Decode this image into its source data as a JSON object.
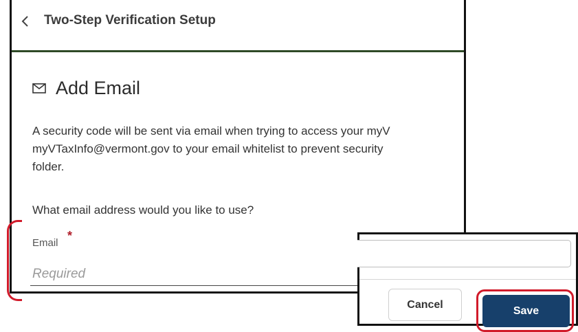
{
  "header": {
    "back_icon": "chevron-left-icon",
    "title": "Two-Step Verification Setup"
  },
  "section": {
    "icon": "mail-icon",
    "title": "Add Email",
    "description": "A security code will be sent via email when trying to access your myV\nmyVTaxInfo@vermont.gov to your email whitelist to prevent security\nfolder.",
    "question": "What email address would you like to use?"
  },
  "form": {
    "email_label": "Email",
    "required_marker": "*",
    "email_placeholder": "Required",
    "email_value": ""
  },
  "actions": {
    "cancel_label": "Cancel",
    "save_label": "Save"
  },
  "colors": {
    "header_rule": "#2e4a26",
    "highlight": "#d11a2a",
    "save_button": "#17406b",
    "required_star": "#b01e2a"
  }
}
